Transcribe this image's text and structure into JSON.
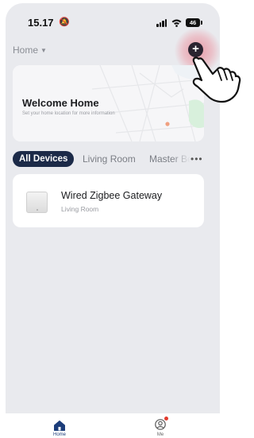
{
  "status_bar": {
    "time": "15.17",
    "battery": "46"
  },
  "header": {
    "home_label": "Home"
  },
  "welcome": {
    "title": "Welcome Home",
    "subtitle": "Set your home location for more information"
  },
  "tabs": [
    {
      "label": "All Devices",
      "active": true
    },
    {
      "label": "Living Room",
      "active": false
    },
    {
      "label": "Master Be",
      "active": false
    }
  ],
  "devices": [
    {
      "name": "Wired Zigbee Gateway",
      "room": "Living Room",
      "icon": "gateway-icon"
    }
  ],
  "nav": [
    {
      "label": "Home",
      "icon": "home-icon",
      "active": true
    },
    {
      "label": "Me",
      "icon": "person-icon",
      "active": false
    }
  ],
  "colors": {
    "accent": "#1c2a48",
    "background": "#e9eaee",
    "highlight": "#e65a6e",
    "badge": "#e23b2e"
  }
}
